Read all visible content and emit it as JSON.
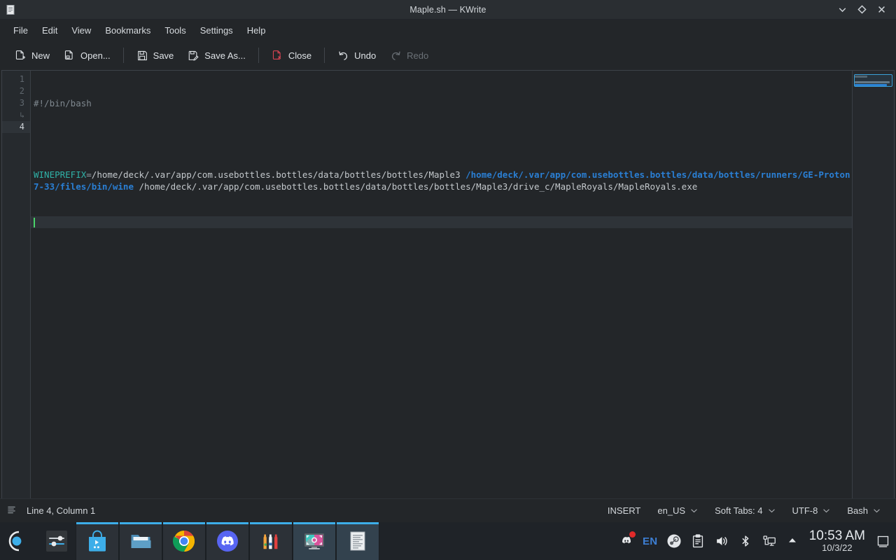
{
  "window": {
    "title": "Maple.sh — KWrite",
    "icon": "text-document-icon",
    "controls": [
      {
        "name": "minimize-button",
        "icon": "chevron-down-icon",
        "label": "Minimize"
      },
      {
        "name": "maximize-button",
        "icon": "diamond-icon",
        "label": "Maximize"
      },
      {
        "name": "close-button",
        "icon": "close-x-icon",
        "label": "Close"
      }
    ]
  },
  "menubar": {
    "items": [
      {
        "label": "File"
      },
      {
        "label": "Edit"
      },
      {
        "label": "View"
      },
      {
        "label": "Bookmarks"
      },
      {
        "label": "Tools"
      },
      {
        "label": "Settings"
      },
      {
        "label": "Help"
      }
    ]
  },
  "toolbar": {
    "buttons": [
      {
        "label": "New",
        "icon": "new-document-icon",
        "enabled": true
      },
      {
        "label": "Open...",
        "icon": "open-folder-icon",
        "enabled": true
      },
      {
        "label": "Save",
        "icon": "floppy-save-icon",
        "enabled": true
      },
      {
        "label": "Save As...",
        "icon": "floppy-pencil-icon",
        "enabled": true
      },
      {
        "label": "Close",
        "icon": "close-document-icon",
        "enabled": true
      },
      {
        "label": "Undo",
        "icon": "undo-arrow-icon",
        "enabled": true
      },
      {
        "label": "Redo",
        "icon": "redo-arrow-icon",
        "enabled": false
      }
    ]
  },
  "editor": {
    "gutter": [
      "1",
      "2",
      "3",
      "↳",
      "4"
    ],
    "lines": {
      "shebang": "#!/bin/bash",
      "blank": "",
      "var_name": "WINEPREFIX",
      "equals": "=",
      "prefix_path": "/home/deck/.var/app/com.usebottles.bottles/data/bottles/bottles/Maple3",
      "wine_cmd": "/home/deck/.var/app/com.usebottles.bottles/data/bottles/runners/GE-Proton7-33/files/bin/wine",
      "exe_path": "/home/deck/.var/app/com.usebottles.bottles/data/bottles/bottles/Maple3/drive_c/MapleRoyals/MapleRoyals.exe"
    },
    "colors": {
      "comment": "#7f888f",
      "variable": "#2fb2a8",
      "command": "#2a7fd4",
      "path": "#c3c8cc",
      "cursor": "#4ad46a",
      "background": "#232629"
    }
  },
  "statusbar": {
    "menu_icon": "lines-menu-icon",
    "position": "Line 4, Column 1",
    "mode": "INSERT",
    "items": [
      {
        "label": "en_US",
        "name": "dictionary-selector"
      },
      {
        "label": "Soft Tabs: 4",
        "name": "indent-selector"
      },
      {
        "label": "UTF-8",
        "name": "encoding-selector"
      },
      {
        "label": "Bash",
        "name": "syntax-mode-selector"
      }
    ]
  },
  "taskbar": {
    "launchers": [
      {
        "name": "application-launcher",
        "icon": "kde-launcher-icon",
        "label": "Application Launcher"
      },
      {
        "name": "system-settings",
        "icon": "settings-sliders-icon",
        "label": "System Settings"
      }
    ],
    "tasks": [
      {
        "name": "discover-store",
        "icon": "discover-bag-icon",
        "label": "Discover",
        "state": "running"
      },
      {
        "name": "file-manager",
        "icon": "folder-icon",
        "label": "Dolphin",
        "state": "running"
      },
      {
        "name": "chrome-browser",
        "icon": "chrome-icon",
        "label": "Google Chrome",
        "state": "running"
      },
      {
        "name": "discord-app",
        "icon": "discord-icon",
        "label": "Discord",
        "state": "running"
      },
      {
        "name": "bottles-app",
        "icon": "bottles-icon",
        "label": "Bottles",
        "state": "running"
      },
      {
        "name": "spectacle-app",
        "icon": "spectacle-icon",
        "label": "Spectacle",
        "state": "active"
      },
      {
        "name": "kwrite-app",
        "icon": "text-document-icon",
        "label": "KWrite",
        "state": "active"
      }
    ],
    "tray": [
      {
        "name": "tray-discord",
        "icon": "discord-icon",
        "label": "Discord",
        "badge": true
      },
      {
        "name": "tray-keyboard-layout",
        "icon": "keyboard-layout-icon",
        "label": "EN"
      },
      {
        "name": "tray-steam",
        "icon": "steam-icon",
        "label": "Steam"
      },
      {
        "name": "tray-clipboard",
        "icon": "clipboard-icon",
        "label": "Clipboard"
      },
      {
        "name": "tray-volume",
        "icon": "speaker-icon",
        "label": "Volume"
      },
      {
        "name": "tray-bluetooth",
        "icon": "bluetooth-icon",
        "label": "Bluetooth"
      },
      {
        "name": "tray-network",
        "icon": "network-display-icon",
        "label": "Network"
      },
      {
        "name": "tray-expand",
        "icon": "chevron-up-icon",
        "label": "Show hidden icons"
      }
    ],
    "clock": {
      "time": "10:53 AM",
      "date": "10/3/22"
    },
    "show_desktop": {
      "name": "show-desktop-button",
      "icon": "show-desktop-icon",
      "label": "Show Desktop"
    }
  }
}
